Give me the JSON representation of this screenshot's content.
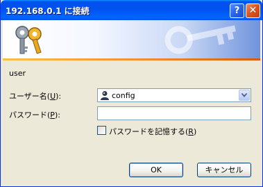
{
  "window": {
    "title": "192.168.0.1 に接続"
  },
  "titlebar": {
    "help_label": "?",
    "close_label": "✕"
  },
  "dialog": {
    "realm": "user",
    "username_label": "ユーザー名(",
    "username_key": "U",
    "username_tail": "):",
    "username_value": "config",
    "password_label": "パスワード(",
    "password_key": "P",
    "password_tail": "):",
    "password_value": "",
    "remember_label": "パスワードを記憶する(",
    "remember_key": "R",
    "remember_tail": ")",
    "remember_checked": false
  },
  "buttons": {
    "ok_label": "OK",
    "cancel_label": "キャンセル"
  },
  "colors": {
    "titlebar": "#0053ee",
    "dialog_bg": "#ece9d8",
    "accent_line": "#f08a2a"
  }
}
